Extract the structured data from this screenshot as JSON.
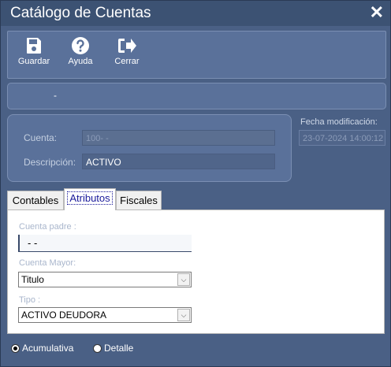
{
  "window": {
    "title": "Catálogo de Cuentas",
    "close_glyph": "✕"
  },
  "toolbar": {
    "save_label": "Guardar",
    "help_label": "Ayuda",
    "close_label": "Cerrar"
  },
  "infobar": {
    "text": "-"
  },
  "header_form": {
    "account_label": "Cuenta:",
    "account_value": "100-  -",
    "description_label": "Descripción:",
    "description_value": "ACTIVO"
  },
  "modified": {
    "label": "Fecha modificación:",
    "value": "23-07-2024 14:00:12"
  },
  "tabs": [
    {
      "label": "Contables"
    },
    {
      "label": "Atributos"
    },
    {
      "label": "Fiscales"
    }
  ],
  "attributes": {
    "parent_label": "Cuenta padre :",
    "parent_value": "-  -",
    "major_label": "Cuenta Mayor:",
    "major_value": "Titulo",
    "type_label": "Tipo :",
    "type_value": "ACTIVO DEUDORA"
  },
  "radios": {
    "accumulative_label": "Acumulativa",
    "detail_label": "Detalle",
    "selected": "Acumulativa"
  }
}
